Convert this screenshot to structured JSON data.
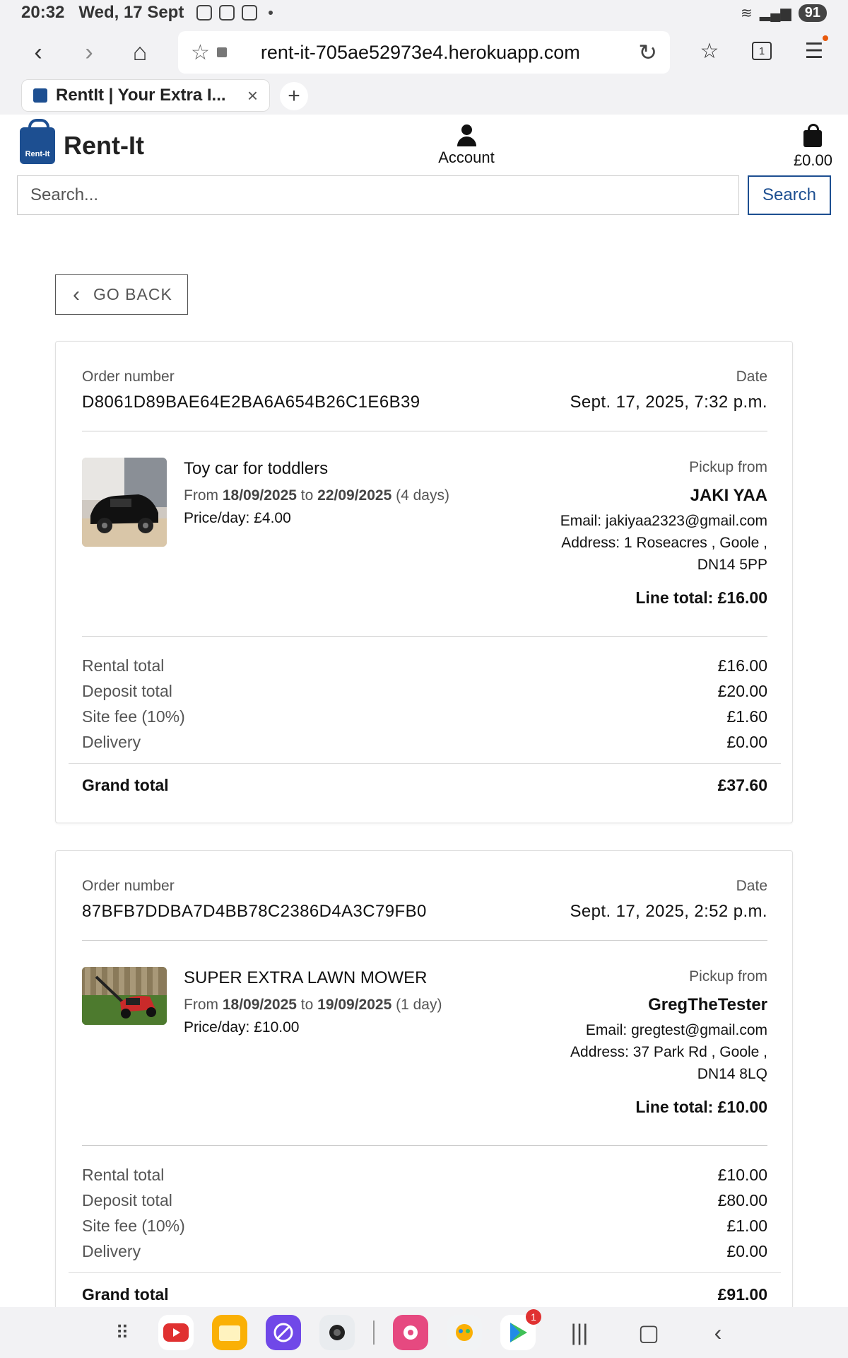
{
  "status_bar": {
    "time": "20:32",
    "date": "Wed, 17 Sept",
    "battery": "91"
  },
  "browser": {
    "url": "rent-it-705ae52973e4.herokuapp.com",
    "tab_title": "RentIt | Your Extra I...",
    "tab_count": "1"
  },
  "site": {
    "logo_badge": "Rent-It",
    "logo_text": "Rent-It",
    "account_label": "Account",
    "cart_total": "£0.00",
    "search_placeholder": "Search...",
    "search_button": "Search"
  },
  "go_back_label": "GO BACK",
  "orders": [
    {
      "order_number_label": "Order number",
      "order_number": "D8061D89BAE64E2BA6A654B26C1E6B39",
      "date_label": "Date",
      "date": "Sept. 17, 2025, 7:32 p.m.",
      "item": {
        "title": "Toy car for toddlers",
        "from_label": "From",
        "from": "18/09/2025",
        "to_label": "to",
        "to": "22/09/2025",
        "duration": "(4 days)",
        "price_per_day": "Price/day: £4.00"
      },
      "pickup": {
        "label": "Pickup from",
        "name": "JAKI YAA",
        "email": "Email: jakiyaa2323@gmail.com",
        "address": "Address: 1 Roseacres , Goole , DN14 5PP",
        "line_total": "Line total: £16.00"
      },
      "totals": [
        {
          "label": "Rental total",
          "value": "£16.00"
        },
        {
          "label": "Deposit total",
          "value": "£20.00"
        },
        {
          "label": "Site fee (10%)",
          "value": "£1.60"
        },
        {
          "label": "Delivery",
          "value": "£0.00"
        }
      ],
      "grand_total_label": "Grand total",
      "grand_total": "£37.60"
    },
    {
      "order_number_label": "Order number",
      "order_number": "87BFB7DDBA7D4BB78C2386D4A3C79FB0",
      "date_label": "Date",
      "date": "Sept. 17, 2025, 2:52 p.m.",
      "item": {
        "title": "SUPER EXTRA LAWN MOWER",
        "from_label": "From",
        "from": "18/09/2025",
        "to_label": "to",
        "to": "19/09/2025",
        "duration": "(1 day)",
        "price_per_day": "Price/day: £10.00"
      },
      "pickup": {
        "label": "Pickup from",
        "name": "GregTheTester",
        "email": "Email: gregtest@gmail.com",
        "address": "Address: 37 Park Rd , Goole , DN14 8LQ",
        "line_total": "Line total: £10.00"
      },
      "totals": [
        {
          "label": "Rental total",
          "value": "£10.00"
        },
        {
          "label": "Deposit total",
          "value": "£80.00"
        },
        {
          "label": "Site fee (10%)",
          "value": "£1.00"
        },
        {
          "label": "Delivery",
          "value": "£0.00"
        }
      ],
      "grand_total_label": "Grand total",
      "grand_total": "£91.00"
    }
  ],
  "navbar": {
    "store_badge": "1"
  }
}
